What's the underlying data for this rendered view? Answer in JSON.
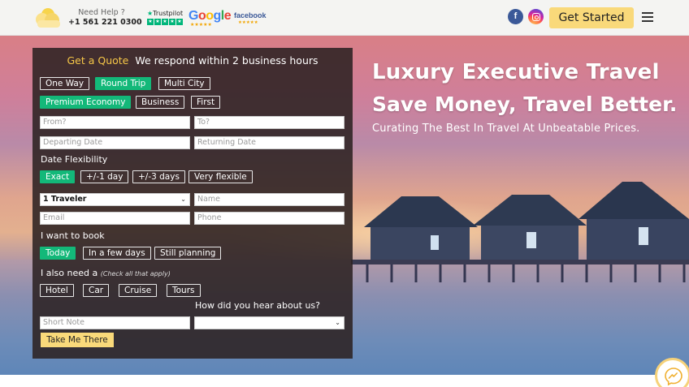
{
  "header": {
    "help_label": "Need Help ?",
    "phone": "+1 561 221 0300",
    "trustpilot": "Trustpilot",
    "google": "Google",
    "facebook": "facebook",
    "cta": "Get Started"
  },
  "hero": {
    "title1": "Luxury Executive Travel",
    "title2": "Save Money, Travel Better.",
    "subtitle": "Curating The Best In Travel At Unbeatable Prices."
  },
  "form": {
    "heading_accent": "Get a Quote",
    "heading": "We respond within 2 business hours",
    "trip_types": [
      "One Way",
      "Round Trip",
      "Multi City"
    ],
    "classes": [
      "Premium Economy",
      "Business",
      "First"
    ],
    "from_placeholder": "From?",
    "to_placeholder": "To?",
    "depart_placeholder": "Departing Date",
    "return_placeholder": "Returning Date",
    "flex_label": "Date Flexibility",
    "flex_options": [
      "Exact",
      "+/-1 day",
      "+/-3 days",
      "Very flexible"
    ],
    "travelers_value": "1 Traveler",
    "name_placeholder": "Name",
    "email_placeholder": "Email",
    "phone_placeholder": "Phone",
    "book_label": "I want to book",
    "book_options": [
      "Today",
      "In a few days",
      "Still planning"
    ],
    "need_label": "I also need a",
    "need_hint": "(Check all that apply)",
    "need_options": [
      "Hotel",
      "Car",
      "Cruise",
      "Tours"
    ],
    "hear_label": "How did you hear about us?",
    "note_placeholder": "Short Note",
    "hear_value": "",
    "submit": "Take Me There"
  },
  "colors": {
    "accent_green": "#13b879",
    "accent_yellow": "#f9d97a",
    "heading_yellow": "#f6c748"
  }
}
